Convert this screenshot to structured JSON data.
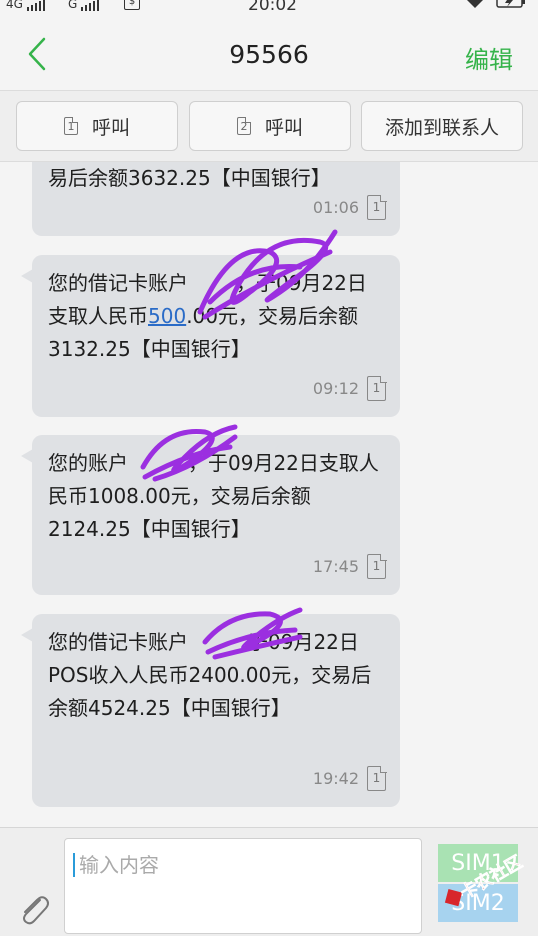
{
  "status_bar": {
    "sim1_label": "4G",
    "sim2_label": "G",
    "time": "20:02"
  },
  "header": {
    "title": "95566",
    "edit_label": "编辑"
  },
  "actions": {
    "call1_label": "呼叫",
    "call1_sim": "1",
    "call2_label": "呼叫",
    "call2_sim": "2",
    "add_contact_label": "添加到联系人"
  },
  "messages": [
    {
      "text": "易后余额3632.25【中国银行】",
      "time": "01:06",
      "sim": "1"
    },
    {
      "text_before_link": "您的借记卡账户",
      "text_line_cont": "，于09月22日支取人民币",
      "link_text": "500",
      "text_after_link": ".00元，交易后余额3132.25【中国银行】",
      "time": "09:12",
      "sim": "1"
    },
    {
      "text": "您的账户　　　，于09月22日支取人民币1008.00元，交易后余额2124.25【中国银行】",
      "time": "17:45",
      "sim": "1"
    },
    {
      "text": "您的借记卡账户　　　于09月22日POS收入人民币2400.00元，交易后余额4524.25【中国银行】",
      "time": "19:42",
      "sim": "1"
    }
  ],
  "composer": {
    "placeholder": "输入内容",
    "sim1_label": "SIM1",
    "sim2_label": "SIM2"
  },
  "watermark": {
    "text": "卡农社区"
  },
  "colors": {
    "accent_green": "#35b34a",
    "bubble_bg": "#dfe1e4",
    "scribble_purple": "#9b2fe0",
    "link_blue": "#2a6bc7"
  }
}
